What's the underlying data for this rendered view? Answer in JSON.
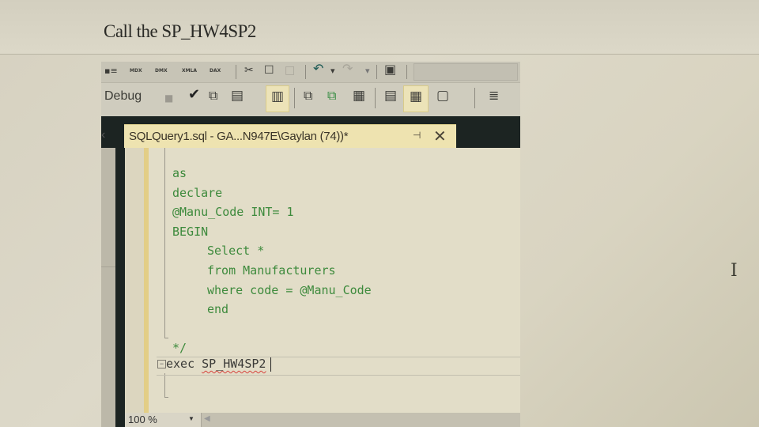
{
  "document": {
    "heading": "Call the SP_HW4SP2"
  },
  "toolbar_row1": {
    "icons": [
      {
        "name": "query-options-icon",
        "glyph": "▪≡"
      },
      {
        "name": "mdx-query-icon",
        "label": "MDX"
      },
      {
        "name": "dmx-query-icon",
        "label": "DMX"
      },
      {
        "name": "xmla-query-icon",
        "label": "XMLA"
      },
      {
        "name": "dax-query-icon",
        "label": "DAX"
      },
      {
        "name": "cut-icon",
        "glyph": "✂"
      },
      {
        "name": "copy-icon",
        "glyph": "☐"
      },
      {
        "name": "paste-icon",
        "glyph": "□"
      },
      {
        "name": "undo-icon",
        "glyph": "↶"
      },
      {
        "name": "undo-dropdown-icon",
        "glyph": "▾"
      },
      {
        "name": "redo-icon",
        "glyph": "↷"
      },
      {
        "name": "redo-dropdown-icon",
        "glyph": "▾"
      },
      {
        "name": "activity-monitor-icon",
        "glyph": "▣"
      }
    ]
  },
  "toolbar_row2": {
    "configuration_label": "Debug",
    "icons": [
      {
        "name": "stop-icon",
        "glyph": "■"
      },
      {
        "name": "parse-checkmark-icon",
        "glyph": "✔"
      },
      {
        "name": "display-estimated-plan-icon",
        "glyph": "⧉"
      },
      {
        "name": "query-designer-icon",
        "glyph": "▤"
      },
      {
        "name": "query-options-panel-icon",
        "glyph": "▥"
      },
      {
        "name": "include-actual-plan-icon",
        "glyph": "⧉"
      },
      {
        "name": "live-query-statistics-icon",
        "glyph": "⧉"
      },
      {
        "name": "client-statistics-icon",
        "glyph": "▦"
      },
      {
        "name": "results-to-text-icon",
        "glyph": "▤"
      },
      {
        "name": "results-to-grid-icon",
        "glyph": "▦"
      },
      {
        "name": "results-to-file-icon",
        "glyph": "▢"
      },
      {
        "name": "comment-lines-icon",
        "glyph": "≣"
      }
    ]
  },
  "tab": {
    "title": "SQLQuery1.sql - GA...N947E\\Gaylan (74))*",
    "pin_glyph": "⊣",
    "close_glyph": "✕"
  },
  "editor": {
    "code_lines": [
      {
        "text": "as",
        "indent": 0
      },
      {
        "text": "declare",
        "indent": 0
      },
      {
        "text": "@Manu_Code INT= 1",
        "indent": 0
      },
      {
        "text": "BEGIN",
        "indent": 0
      },
      {
        "text": "Select *",
        "indent": 1
      },
      {
        "text": "from Manufacturers",
        "indent": 1
      },
      {
        "text": "where code = @Manu_Code",
        "indent": 1
      },
      {
        "text": "end",
        "indent": 1
      },
      {
        "text": "",
        "indent": 0
      },
      {
        "text": "*/",
        "indent": 0
      }
    ],
    "exec_keyword": "exec",
    "exec_target": "SP_HW4SP2"
  },
  "statusbar": {
    "zoom": "100 %"
  }
}
